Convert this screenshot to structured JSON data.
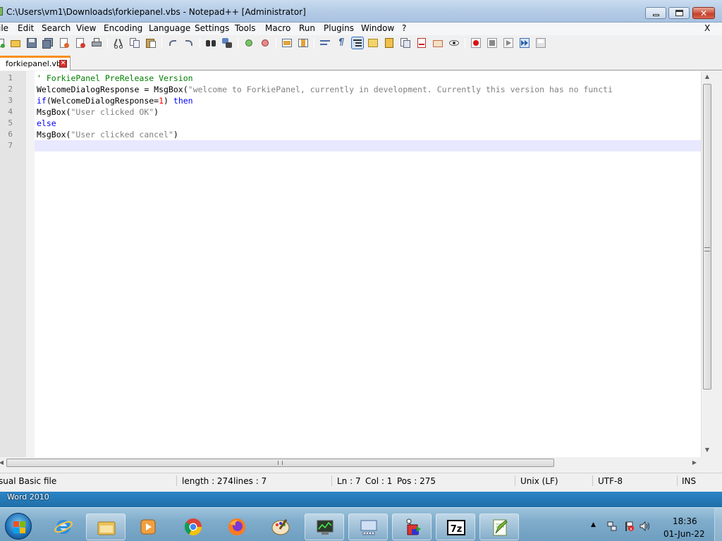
{
  "window": {
    "title": "C:\\Users\\vm1\\Downloads\\forkiepanel.vbs - Notepad++ [Administrator]"
  },
  "menu": {
    "items": [
      "ile",
      "Edit",
      "Search",
      "View",
      "Encoding",
      "Language",
      "Settings",
      "Tools",
      "Macro",
      "Run",
      "Plugins",
      "Window",
      "?"
    ],
    "close_doc": "X"
  },
  "toolbar": {
    "buttons": [
      "new-file",
      "open-file",
      "save",
      "save-all",
      "close",
      "close-all",
      "print",
      "cut",
      "copy",
      "paste",
      "undo",
      "redo",
      "find",
      "replace",
      "zoom-in",
      "zoom-out",
      "sync-vertical",
      "sync-horizontal",
      "word-wrap",
      "show-all-characters",
      "indent-guide",
      "user-defined-language",
      "document-map",
      "function-list",
      "folder-as-workspace",
      "monitoring",
      "record-macro",
      "stop-recording",
      "playback-macro",
      "run-macro-multiple",
      "save-macro"
    ]
  },
  "tab": {
    "label": "forkiepanel.vbs"
  },
  "editor": {
    "line_numbers": [
      "1",
      "2",
      "3",
      "4",
      "5",
      "6",
      "7"
    ],
    "lines": [
      [
        {
          "t": "' ForkiePanel PreRelease Version",
          "c": "comment"
        }
      ],
      [
        {
          "t": "WelcomeDialogResponse = MsgBox(",
          "c": "ident"
        },
        {
          "t": "\"welcome to ForkiePanel, currently in development. Currently this version has no functi",
          "c": "str"
        }
      ],
      [
        {
          "t": "if",
          "c": "kw"
        },
        {
          "t": "(WelcomeDialogResponse=",
          "c": "ident"
        },
        {
          "t": "1",
          "c": "num"
        },
        {
          "t": ") ",
          "c": "ident"
        },
        {
          "t": "then",
          "c": "kw"
        }
      ],
      [
        {
          "t": "MsgBox(",
          "c": "ident"
        },
        {
          "t": "\"User clicked OK\"",
          "c": "str"
        },
        {
          "t": ")",
          "c": "ident"
        }
      ],
      [
        {
          "t": "else",
          "c": "kw"
        }
      ],
      [
        {
          "t": "MsgBox(",
          "c": "ident"
        },
        {
          "t": "\"User clicked cancel\"",
          "c": "str"
        },
        {
          "t": ")",
          "c": "ident"
        }
      ],
      []
    ],
    "current_line": 7
  },
  "status": {
    "file_type": "sual Basic file",
    "length": "length : 274",
    "lines": "lines : 7",
    "ln": "Ln : 7",
    "col": "Col : 1",
    "pos": "Pos : 275",
    "eol": "Unix (LF)",
    "encoding": "UTF-8",
    "mode": "INS"
  },
  "desktop": {
    "label": "Word 2010"
  },
  "taskbar": {
    "buttons": [
      "internet-explorer",
      "windows-explorer",
      "media-player",
      "chrome",
      "firefox",
      "paint",
      "task-manager",
      "on-screen-keyboard",
      "app-cube",
      "7-zip",
      "notepad-plus-plus"
    ],
    "clock_time": "18:36",
    "clock_date": "01-Jun-22"
  },
  "colors": {
    "comment": "#008000",
    "keyword": "#0000ff",
    "string": "#808080",
    "number": "#ff0000",
    "tab_accent": "#fa8e1b"
  }
}
